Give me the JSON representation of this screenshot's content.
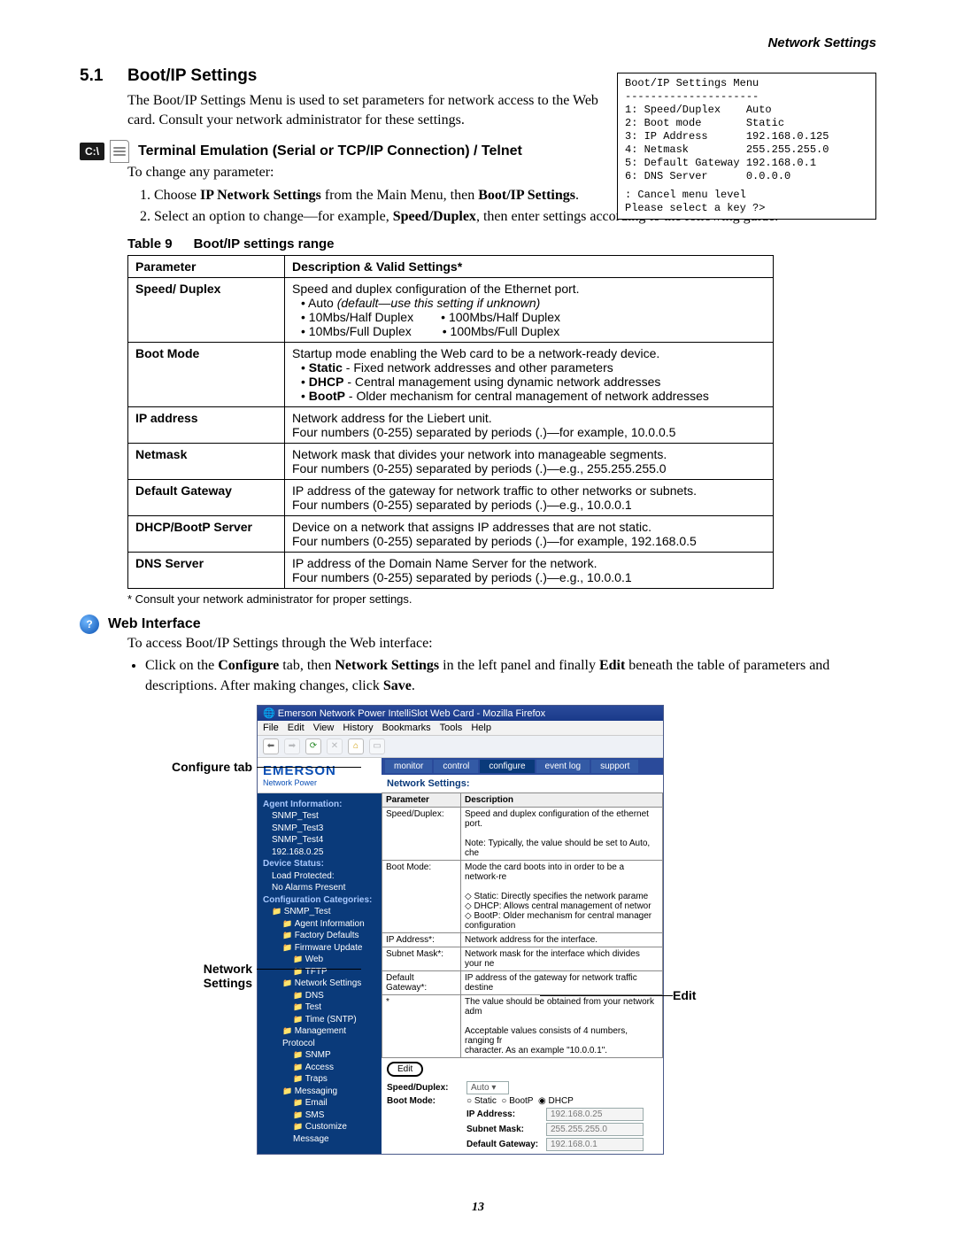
{
  "header": {
    "right": "Network Settings"
  },
  "section": {
    "num": "5.1",
    "title": "Boot/IP Settings"
  },
  "intro": "The Boot/IP Settings Menu is used to set parameters for network access to the Web card. Consult your network administrator for these settings.",
  "terminal": {
    "title": "Boot/IP Settings Menu",
    "sep": "---------------------",
    "rows": [
      [
        "1:",
        "Speed/Duplex",
        "Auto"
      ],
      [
        "2:",
        "Boot mode",
        "Static"
      ],
      [
        "3:",
        "IP Address",
        "192.168.0.125"
      ],
      [
        "4:",
        "Netmask",
        "255.255.255.0"
      ],
      [
        "5:",
        "Default Gateway",
        "192.168.0.1"
      ],
      [
        "6:",
        "DNS Server",
        "0.0.0.0"
      ]
    ],
    "esc": "<ESC>: Cancel menu level",
    "prompt": "Please select a key ?>"
  },
  "sub1": {
    "cmd_icon": "C:\\",
    "title": "Terminal Emulation (Serial or TCP/IP Connection) / Telnet",
    "lead": "To change any parameter:",
    "steps": [
      "Choose <b>IP Network Settings</b> from the Main Menu, then <b>Boot/IP Settings</b>.",
      "Select an option to change—for example, <b>Speed/Duplex</b>, then enter settings according to the following guide."
    ]
  },
  "table": {
    "caption_a": "Table 9",
    "caption_b": "Boot/IP settings range",
    "head": [
      "Parameter",
      "Description & Valid Settings*"
    ],
    "rows": [
      [
        "Speed/ Duplex",
        "Speed and duplex configuration of the Ethernet port.<br><span class='bul'>• Auto <i>(default—use this setting if unknown)</i></span><br><span class='bul'>• 10Mbs/Half Duplex&nbsp;&nbsp;&nbsp;&nbsp;&nbsp;&nbsp;&nbsp;&nbsp;• 100Mbs/Half Duplex</span><br><span class='bul'>• 10Mbs/Full Duplex&nbsp;&nbsp;&nbsp;&nbsp;&nbsp;&nbsp;&nbsp;&nbsp;&nbsp;• 100Mbs/Full Duplex</span>"
      ],
      [
        "Boot Mode",
        "Startup mode enabling the Web card to be a network-ready device.<br><span class='bul'>• <b>Static</b> - Fixed network addresses and other parameters</span><br><span class='bul'>• <b>DHCP</b> - Central management using dynamic network addresses</span><br><span class='bul'>• <b>BootP</b> - Older mechanism for central management of network addresses</span>"
      ],
      [
        "IP address",
        "Network address for the Liebert unit.<br>Four numbers (0-255) separated by periods (.)—for example, 10.0.0.5"
      ],
      [
        "Netmask",
        "Network mask that divides your network into manageable segments.<br>Four numbers (0-255) separated by periods (.)—e.g., 255.255.255.0"
      ],
      [
        "Default Gateway",
        "IP address of the gateway for network traffic to other networks or subnets.<br>Four numbers (0-255) separated by periods (.)—e.g., 10.0.0.1"
      ],
      [
        "DHCP/BootP Server",
        "Device on a network that assigns IP addresses that are not static.<br>Four numbers (0-255) separated by periods (.)—for example, 192.168.0.5"
      ],
      [
        "DNS Server",
        "IP address of the Domain Name Server for the network.<br>Four numbers (0-255) separated by periods (.)—e.g., 10.0.0.1"
      ]
    ],
    "note": "* Consult your network administrator for proper settings."
  },
  "sub2": {
    "title": "Web Interface",
    "lead": "To access Boot/IP Settings through the Web interface:",
    "bullet": "Click on the <b>Configure</b> tab, then <b>Network Settings</b> in the left panel and finally <b>Edit</b> beneath the table of parameters and descriptions. After making changes, click <b>Save</b>."
  },
  "callouts": {
    "configure": "Configure tab",
    "network": "Network\nSettings",
    "edit": "Edit"
  },
  "shot": {
    "title": "Emerson Network Power IntelliSlot Web Card - Mozilla Firefox",
    "menus": [
      "File",
      "Edit",
      "View",
      "History",
      "Bookmarks",
      "Tools",
      "Help"
    ],
    "brand": "EMERSON",
    "brand_sub": "Network Power",
    "tabs": [
      "monitor",
      "control",
      "configure",
      "event log",
      "support"
    ],
    "side": {
      "agent_h": "Agent Information:",
      "agent": [
        "SNMP_Test",
        "SNMP_Test3",
        "SNMP_Test4",
        "192.168.0.25"
      ],
      "status_h": "Device Status:",
      "status": [
        "Load Protected:",
        "No Alarms Present"
      ],
      "cat_h": "Configuration Categories:",
      "tree": [
        {
          "lvl": 1,
          "t": "SNMP_Test"
        },
        {
          "lvl": 2,
          "t": "Agent Information"
        },
        {
          "lvl": 2,
          "t": "Factory Defaults"
        },
        {
          "lvl": 2,
          "t": "Firmware Update"
        },
        {
          "lvl": 3,
          "t": "Web"
        },
        {
          "lvl": 3,
          "t": "TFTP"
        },
        {
          "lvl": 2,
          "t": "Network Settings"
        },
        {
          "lvl": 3,
          "t": "DNS"
        },
        {
          "lvl": 3,
          "t": "Test"
        },
        {
          "lvl": 3,
          "t": "Time (SNTP)"
        },
        {
          "lvl": 2,
          "t": "Management Protocol"
        },
        {
          "lvl": 3,
          "t": "SNMP"
        },
        {
          "lvl": 3,
          "t": "Access"
        },
        {
          "lvl": 3,
          "t": "Traps"
        },
        {
          "lvl": 2,
          "t": "Messaging"
        },
        {
          "lvl": 3,
          "t": "Email"
        },
        {
          "lvl": 3,
          "t": "SMS"
        },
        {
          "lvl": 3,
          "t": "Customize Message"
        }
      ]
    },
    "main": {
      "h": "Network Settings:",
      "thead": [
        "Parameter",
        "Description"
      ],
      "rows": [
        [
          "Speed/Duplex:",
          "Speed and duplex configuration of the ethernet port.<br><br>Note: Typically, the value should be set to Auto, che"
        ],
        [
          "Boot Mode:",
          "Mode the card boots into in order to be a network-re<br><br>◇ Static: Directly specifies the network parame<br>◇ DHCP: Allows central management of networ<br>◇ BootP: Older mechanism for central manager configuration"
        ],
        [
          "IP Address*:",
          "Network address for the interface."
        ],
        [
          "Subnet Mask*:",
          "Network mask for the interface which divides your ne"
        ],
        [
          "Default Gateway*:",
          "IP address of the gateway for network traffic destine"
        ],
        [
          "*",
          "The value should be obtained from your network adm<br><br>Acceptable values consists of 4 numbers, ranging fr<br>character. As an example \"10.0.0.1\"."
        ]
      ],
      "edit_btn": "Edit",
      "form": {
        "speed_l": "Speed/Duplex:",
        "speed_v": "Auto",
        "boot_l": "Boot Mode:",
        "boot_opts": [
          "Static",
          "BootP",
          "DHCP"
        ],
        "ip_l": "IP Address:",
        "ip_v": "192.168.0.25",
        "mask_l": "Subnet Mask:",
        "mask_v": "255.255.255.0",
        "gw_l": "Default Gateway:",
        "gw_v": "192.168.0.1"
      }
    }
  },
  "pagenum": "13"
}
